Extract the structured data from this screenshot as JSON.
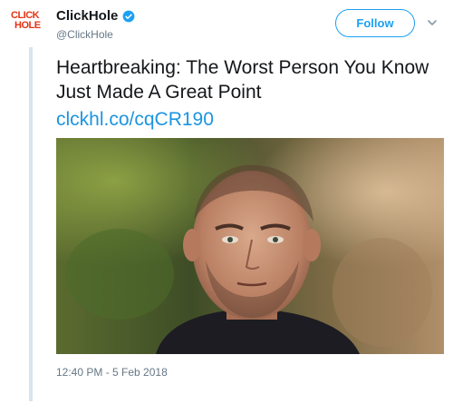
{
  "account": {
    "logo_line1": "CLICK",
    "logo_line2": "HOLE",
    "display_name": "ClickHole",
    "handle": "@ClickHole",
    "verified": true
  },
  "actions": {
    "follow_label": "Follow"
  },
  "tweet": {
    "text": "Heartbreaking: The Worst Person You Know Just Made A Great Point",
    "link": "clckhl.co/cqCR190",
    "timestamp": "12:40 PM - 5 Feb 2018"
  },
  "colors": {
    "accent": "#1da1f2",
    "link": "#1b95e0",
    "brand_red": "#e63312",
    "text": "#14171a",
    "muted": "#657786"
  },
  "icons": {
    "verified": "verified-badge-icon",
    "more": "chevron-down-icon"
  }
}
